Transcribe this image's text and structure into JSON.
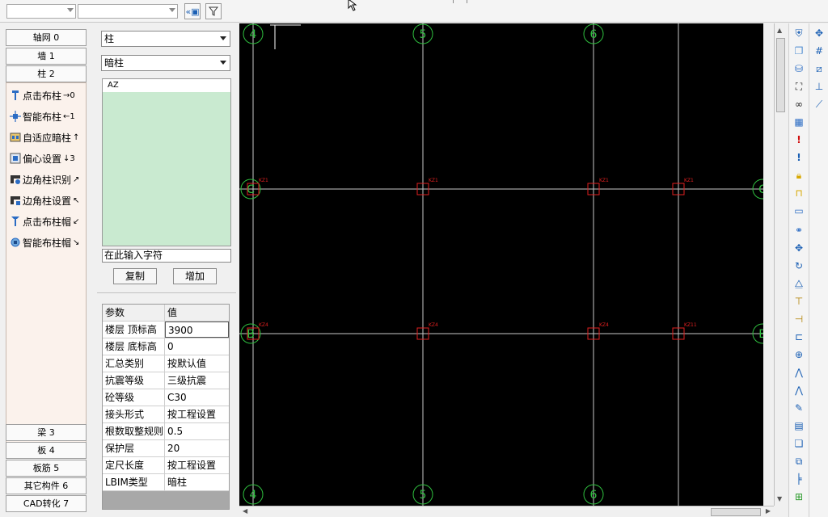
{
  "left_nav": {
    "top_buttons": [
      "轴网 0",
      "墙 1",
      "柱 2"
    ],
    "sub_items": [
      {
        "label": "点击布柱",
        "key": "→0",
        "icon": "pin-column-icon"
      },
      {
        "label": "智能布柱",
        "key": "←1",
        "icon": "smart-column-icon"
      },
      {
        "label": "自适应暗柱",
        "key": "↑",
        "icon": "adaptive-column-icon"
      },
      {
        "label": "偏心设置",
        "key": "↓3",
        "icon": "offset-icon"
      },
      {
        "label": "边角柱识别",
        "key": "↗",
        "icon": "corner-detect-icon"
      },
      {
        "label": "边角柱设置",
        "key": "↖",
        "icon": "corner-set-icon"
      },
      {
        "label": "点击布柱帽",
        "key": "↙",
        "icon": "pin-cap-icon"
      },
      {
        "label": "智能布柱帽",
        "key": "↘",
        "icon": "smart-cap-icon"
      }
    ],
    "bottom_buttons": [
      "梁 3",
      "板 4",
      "板筋 5",
      "其它构件 6",
      "CAD转化 7"
    ]
  },
  "mid_panel": {
    "category_select": "柱",
    "type_select": "暗柱",
    "list_items": [
      "AZ"
    ],
    "filter_placeholder": "在此输入字符",
    "copy_button": "复制",
    "add_button": "增加",
    "table_header": {
      "param": "参数",
      "value": "值"
    },
    "properties": [
      {
        "name": "楼层 顶标高",
        "value": "3900"
      },
      {
        "name": "楼层 底标高",
        "value": "0"
      },
      {
        "name": "汇总类别",
        "value": "按默认值"
      },
      {
        "name": "抗震等级",
        "value": "三级抗震"
      },
      {
        "name": "砼等级",
        "value": "C30"
      },
      {
        "name": "接头形式",
        "value": "按工程设置"
      },
      {
        "name": "根数取整规则",
        "value": "0.5"
      },
      {
        "name": "保护层",
        "value": "20"
      },
      {
        "name": "定尺长度",
        "value": "按工程设置"
      },
      {
        "name": "LBIM类型",
        "value": "暗柱"
      }
    ]
  },
  "canvas": {
    "axis_top_labels": [
      "4",
      "5",
      "6"
    ],
    "axis_bottom_labels": [
      "4",
      "5",
      "6"
    ],
    "axis_left_labels": [
      "C",
      "B"
    ],
    "columns_row1": [
      "KZ1",
      "KZ1",
      "KZ1",
      "KZ1"
    ],
    "columns_row2": [
      "KZ4",
      "KZ4",
      "KZ4",
      "KZ11"
    ],
    "grid_color": "#2fbf3f",
    "line_color": "#c8c8c8",
    "column_color": "#e02020"
  }
}
